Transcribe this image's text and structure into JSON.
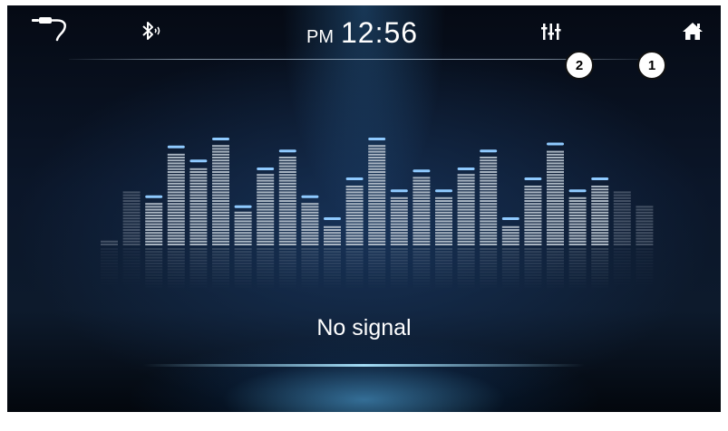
{
  "status_bar": {
    "clock_ampm": "PM",
    "clock_time": "12:56",
    "icons": [
      "aux-cable-icon",
      "bluetooth-icon",
      "equalizer-icon",
      "home-icon"
    ]
  },
  "callouts": {
    "equalizer": "2",
    "home": "1"
  },
  "main": {
    "status_text": "No signal"
  },
  "equalizer_levels": [
    0.0,
    0.55,
    0.42,
    0.92,
    0.78,
    1.0,
    0.32,
    0.7,
    0.88,
    0.42,
    0.2,
    0.6,
    1.0,
    0.48,
    0.68,
    0.48,
    0.7,
    0.88,
    0.2,
    0.6,
    0.95,
    0.48,
    0.6,
    0.55,
    0.4
  ],
  "colors": {
    "accent_peak": "#8fcaff",
    "bar": "#b9c4cf",
    "text": "#ffffff",
    "background": "#0b1629"
  }
}
